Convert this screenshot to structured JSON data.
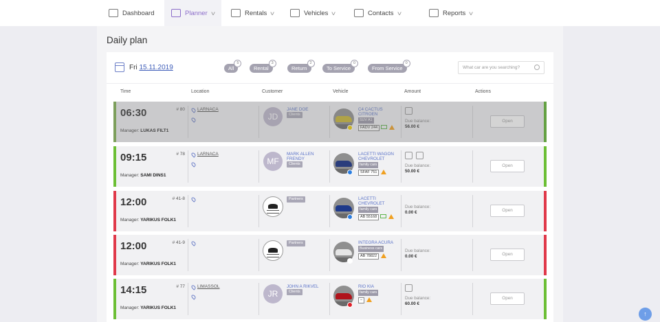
{
  "nav": [
    {
      "label": "Dashboard",
      "icon": "dashboard-icon",
      "active": false,
      "chevron": false
    },
    {
      "label": "Planner",
      "icon": "planner-icon",
      "active": true,
      "chevron": true
    },
    {
      "label": "Rentals",
      "icon": "rentals-icon",
      "active": false,
      "chevron": true
    },
    {
      "label": "Vehicles",
      "icon": "car-icon",
      "active": false,
      "chevron": true
    },
    {
      "label": "Contacts",
      "icon": "contacts-icon",
      "active": false,
      "chevron": true
    },
    {
      "label": "Reports",
      "icon": "reports-icon",
      "active": false,
      "chevron": true
    }
  ],
  "page_title": "Daily plan",
  "date": {
    "prefix": "Fri",
    "value": "15.11.2019"
  },
  "filters": [
    {
      "label": "All",
      "count": "5"
    },
    {
      "label": "Rental",
      "count": "3"
    },
    {
      "label": "Return",
      "count": "2"
    },
    {
      "label": "To Service",
      "count": "0"
    },
    {
      "label": "From Service",
      "count": "0"
    }
  ],
  "search_placeholder": "What car are you searching?",
  "columns": [
    "Time",
    "Location",
    "Customer",
    "Vehicle",
    "Amount",
    "Actions"
  ],
  "rows": [
    {
      "time": "06:30",
      "number": "# 80",
      "manager_label": "Manager:",
      "manager": "LUKAS FILT1",
      "location": "LARNACA",
      "customer": "JANE DOE",
      "initials": "JD",
      "customer_type": "Clients",
      "vehicle": "C4 CACTUS CITROEN",
      "category": "SUV A1",
      "plate": "FADV 244",
      "due_label": "Due balance:",
      "due": "56.00 €",
      "open": "Open",
      "left_color": "#7fb14e",
      "right_color": "#5ab42a",
      "car_color": "#c9b630",
      "dot_color": "#f4d000",
      "disabled": true
    },
    {
      "time": "09:15",
      "number": "# 78",
      "manager_label": "Manager:",
      "manager": "SAMI DINS1",
      "location": "LARNACA",
      "customer": "MARK ALLEN FRENDY",
      "initials": "MF",
      "customer_type": "Clients",
      "vehicle": "LACETTI WAGON CHEVROLET",
      "category": "family cars",
      "plate": "SFAF 751",
      "due_label": "Due balance:",
      "due": "50.00 €",
      "open": "Open",
      "left_color": "#6cbf35",
      "right_color": "#6cbf35",
      "car_color": "#2a3d7c",
      "dot_color": "#2a7de1",
      "disabled": false
    },
    {
      "time": "12:00",
      "number": "# 41-8",
      "manager_label": "Manager:",
      "manager": "YARIKUS FOLK1",
      "location": "",
      "customer": "",
      "initials": "",
      "customer_type": "Partners",
      "vehicle": "LACETTI CHEVROLET",
      "category": "family cars",
      "plate": "AB 55168",
      "due_label": "Due balance:",
      "due": "0.00 €",
      "open": "Open",
      "left_color": "#e0394a",
      "right_color": "#e0394a",
      "car_color": "#1f3a8a",
      "dot_color": "#2a7de1",
      "disabled": false
    },
    {
      "time": "12:00",
      "number": "# 41-9",
      "manager_label": "Manager:",
      "manager": "YARIKUS FOLK1",
      "location": "",
      "customer": "",
      "initials": "",
      "customer_type": "Partners",
      "vehicle": "INTEGRA ACURA",
      "category": "Business cars",
      "plate": "AB 78822",
      "due_label": "Due balance:",
      "due": "0.00 €",
      "open": "Open",
      "left_color": "#e0394a",
      "right_color": "#e0394a",
      "car_color": "#e5e5e5",
      "dot_color": "#ffffff",
      "disabled": false
    },
    {
      "time": "14:15",
      "number": "# 77",
      "manager_label": "Manager:",
      "manager": "YARIKUS FOLK1",
      "location": "LIMASSOL",
      "customer": "JOHN A RIKVEL",
      "initials": "JR",
      "customer_type": "Clients",
      "vehicle": "RIO KIA",
      "category": "family cars",
      "plate": "–",
      "due_label": "Due balance:",
      "due": "60.00 €",
      "open": "Open",
      "left_color": "#6cbf35",
      "right_color": "#6cbf35",
      "car_color": "#b0141c",
      "dot_color": "#e0202a",
      "disabled": false
    }
  ],
  "scroll_top_icon": "arrow-up-icon"
}
